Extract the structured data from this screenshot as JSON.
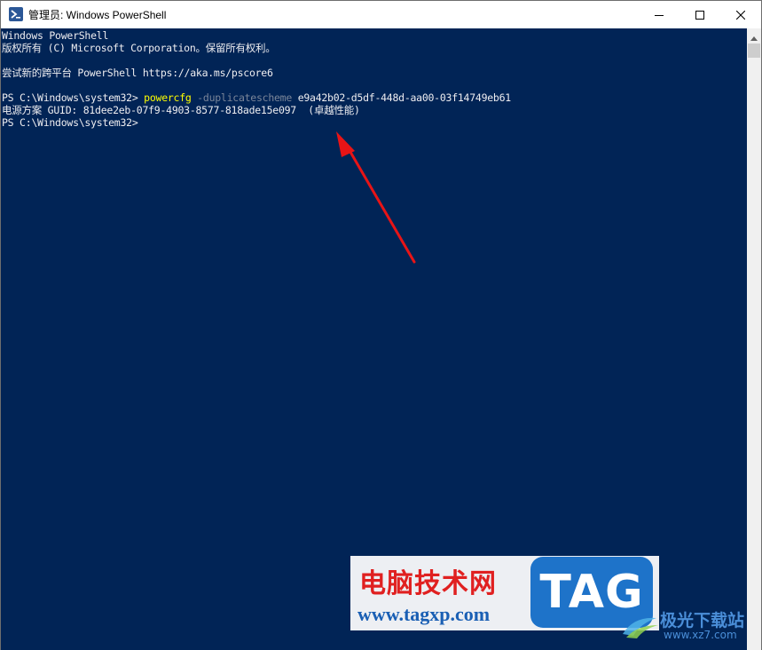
{
  "window": {
    "title": "管理员: Windows PowerShell",
    "icon": "powershell-icon",
    "controls": {
      "minimize": "minimize-icon",
      "maximize": "maximize-icon",
      "close": "close-icon"
    }
  },
  "console": {
    "background": "#012456",
    "text_color": "#eeedf0",
    "command_color": "#ffff00",
    "parameter_color": "#7a8599",
    "lines": {
      "banner_title": "Windows PowerShell",
      "copyright": "版权所有 (C) Microsoft Corporation。保留所有权利。",
      "try_new": "尝试新的跨平台 PowerShell https://aka.ms/pscore6",
      "prompt1": "PS C:\\Windows\\system32> ",
      "command": "powercfg",
      "parameter": " -duplicatescheme",
      "argument": " e9a42b02-d5df-448d-aa00-03f14749eb61",
      "output": "电源方案 GUID: 81dee2eb-07f9-4903-8577-818ade15e097  (卓越性能)",
      "prompt2": "PS C:\\Windows\\system32>"
    }
  },
  "annotation": {
    "arrow_color": "#e81416"
  },
  "watermark": {
    "site_name_cn": "电脑技术网",
    "site_url": "www.tagxp.com",
    "badge_text": "TAG",
    "badge_color": "#1e73c9",
    "partner_name_cn": "极光下载站",
    "partner_url": "www.xz7.com"
  }
}
